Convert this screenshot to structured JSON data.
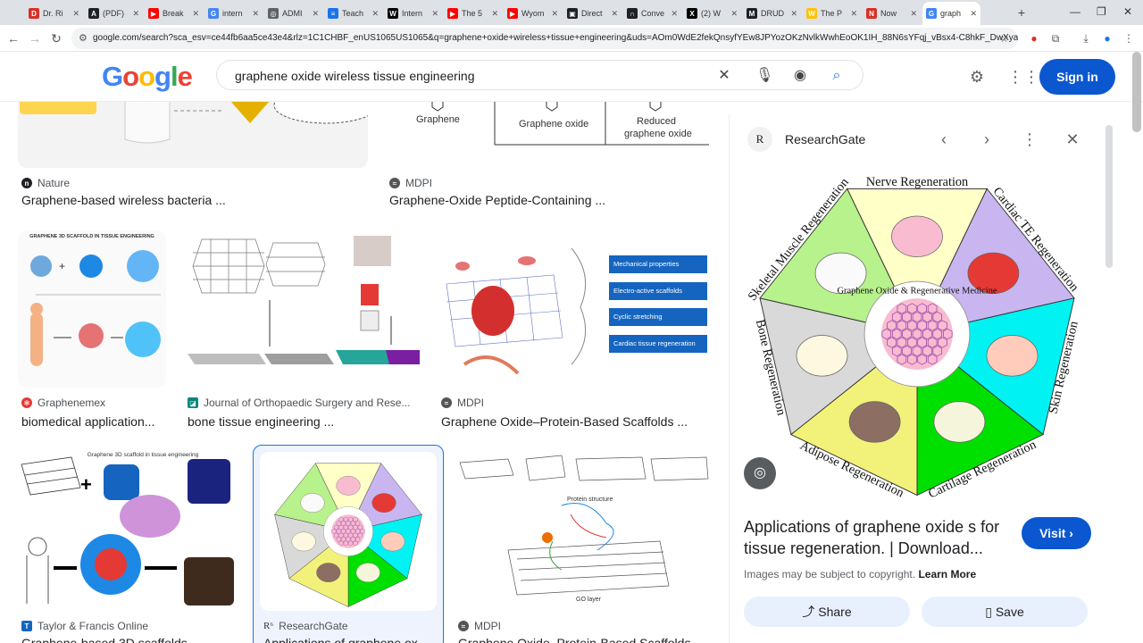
{
  "browser": {
    "tabs": [
      {
        "label": "Dr. Ri",
        "color": "#d93025",
        "glyph": "D"
      },
      {
        "label": "(PDF)",
        "color": "#202124",
        "glyph": "A"
      },
      {
        "label": "Break",
        "color": "#ff0000",
        "glyph": "▶"
      },
      {
        "label": "intern",
        "color": "#4285f4",
        "glyph": "G"
      },
      {
        "label": "ADMI",
        "color": "#5f6368",
        "glyph": "◎"
      },
      {
        "label": "Teach",
        "color": "#1a73e8",
        "glyph": "≡"
      },
      {
        "label": "Intern",
        "color": "#000000",
        "glyph": "W"
      },
      {
        "label": "The 5",
        "color": "#ff0000",
        "glyph": "▶"
      },
      {
        "label": "Wyom",
        "color": "#ff0000",
        "glyph": "▶"
      },
      {
        "label": "Direct",
        "color": "#202124",
        "glyph": "▣"
      },
      {
        "label": "Conve",
        "color": "#202124",
        "glyph": "∩"
      },
      {
        "label": "(2) W",
        "color": "#000000",
        "glyph": "X"
      },
      {
        "label": "DRUD",
        "color": "#202124",
        "glyph": "M"
      },
      {
        "label": "The P",
        "color": "#ffc107",
        "glyph": "W"
      },
      {
        "label": "Now",
        "color": "#d93025",
        "glyph": "N"
      },
      {
        "label": "graph",
        "color": "#4285f4",
        "glyph": "G"
      }
    ],
    "new_tab": "+",
    "url": "google.com/search?sca_esv=ce44fb6aa5ce43e4&rlz=1C1CHBF_enUS1065US1065&q=graphene+oxide+wireless+tissue+engineering&uds=AOm0WdE2fekQnsyfYEw8JPYozOKzNvlkWwhEoOK1IH_88N6sYFqj_vBsx4-C8hkF_DwXyaHR_gvaI7no..."
  },
  "header": {
    "logo": [
      "G",
      "o",
      "o",
      "g",
      "l",
      "e"
    ],
    "query": "graphene oxide wireless tissue engineering",
    "signin": "Sign in"
  },
  "results": [
    {
      "source": "Nature",
      "title": "Graphene-based wireless bacteria ...",
      "fav_color": "#202124",
      "fav": "n"
    },
    {
      "source": "MDPI",
      "title": "Graphene-Oxide Peptide-Containing ...",
      "fav_color": "#555555",
      "fav": "≈"
    },
    {
      "source": "Graphenemex",
      "title": "biomedical application...",
      "fav_color": "#e53935",
      "fav": "✻"
    },
    {
      "source": "Journal of Orthopaedic Surgery and Rese...",
      "title": "bone tissue engineering ...",
      "fav_color": "#00897b",
      "fav": "◪"
    },
    {
      "source": "MDPI",
      "title": "Graphene Oxide–Protein-Based Scaffolds ...",
      "fav_color": "#555555",
      "fav": "≈"
    },
    {
      "source": "Taylor & Francis Online",
      "title": "Graphene-based 3D scaffolds ...",
      "fav_color": "#1565c0",
      "fav": "T"
    },
    {
      "source": "ResearchGate",
      "title": "Applications of graphene ox...",
      "fav_color": "#333333",
      "fav": "R"
    },
    {
      "source": "MDPI",
      "title": "Graphene Oxide–Protein-Based Scaffolds ...",
      "fav_color": "#555555",
      "fav": "≈"
    }
  ],
  "thumb_text": {
    "graphene": "Graphene",
    "graphene_oxide": "Graphene oxide",
    "reduced_1": "Reduced",
    "reduced_2": "graphene oxide",
    "scaffold_title": "GRAPHENE 3D SCAFFOLD IN TISSUE ENGINEERING",
    "props": [
      "Mechanical properties",
      "Electro-active scaffolds",
      "Cyclic stretching",
      "Cardiac tissue regeneration"
    ],
    "graphene_3d": "Graphene 3D scaffold in tissue engineering",
    "protein_structure": "Protein structure",
    "go_layer": "GO layer"
  },
  "panel": {
    "site": "ResearchGate",
    "logo": "R",
    "title": "Applications of graphene oxide s for tissue regeneration. | Download...",
    "visit": "Visit",
    "copyright": "Images may be subject to copyright.",
    "learn_more": "Learn More",
    "share": "Share",
    "save": "Save",
    "figure": {
      "center": "Graphene Oxide & Regenerative Medicine",
      "segments": [
        "Nerve Regeneration",
        "Cardiac TE Regeneration",
        "Skin Regeneration",
        "Cartilage Regeneration",
        "Adipose Regeneration",
        "Bone Regeneration",
        "Skeletal Muscle Regeneration"
      ],
      "colors": [
        "#ffffc8",
        "#c9b6f0",
        "#00f2f2",
        "#00e000",
        "#f2f27a",
        "#d9d9d9",
        "#b7f28c"
      ]
    }
  }
}
